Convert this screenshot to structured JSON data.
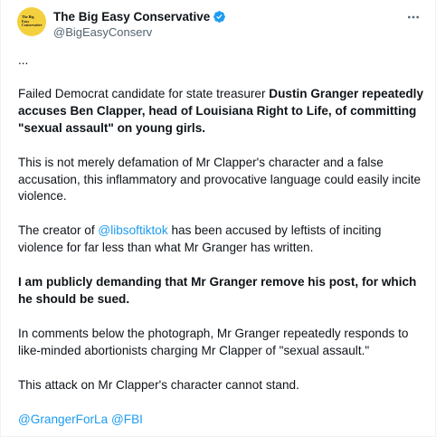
{
  "author": {
    "display_name": "The Big Easy Conservative",
    "handle": "@BigEasyConserv",
    "avatar_text": "The Big Easy Conservative",
    "verified": true
  },
  "menu": {
    "icon": "more-horizontal-icon"
  },
  "colors": {
    "link": "#1d9bf0",
    "avatar_bg": "#f4d03f",
    "verified_badge": "#1d9bf0",
    "secondary_text": "#536471"
  },
  "tweet": {
    "ellipsis": "...",
    "p1_normal": "Failed Democrat candidate for state treasurer ",
    "p1_bold": "Dustin Granger repeatedly accuses Ben Clapper, head of Louisiana Right to Life, of committing \"sexual assault\" on young girls.",
    "p2": "This is not merely defamation of Mr Clapper's character and a false accusation, this inflammatory and provocative language could easily incite violence.",
    "p3_before": "The creator of ",
    "p3_mention": "@libsoftiktok",
    "p3_after": " has been accused by leftists of inciting violence for far less than what Mr Granger has written.",
    "p4": "I am publicly demanding that Mr Granger remove his post, for which he should be sued.",
    "p5": "In comments below the photograph, Mr Granger repeatedly responds to like-minded abortionists charging Mr Clapper of \"sexual assault.\"",
    "p6": "This attack on Mr Clapper's character cannot stand.",
    "mention_1": "@GrangerForLa",
    "mention_2": "@FBI"
  }
}
